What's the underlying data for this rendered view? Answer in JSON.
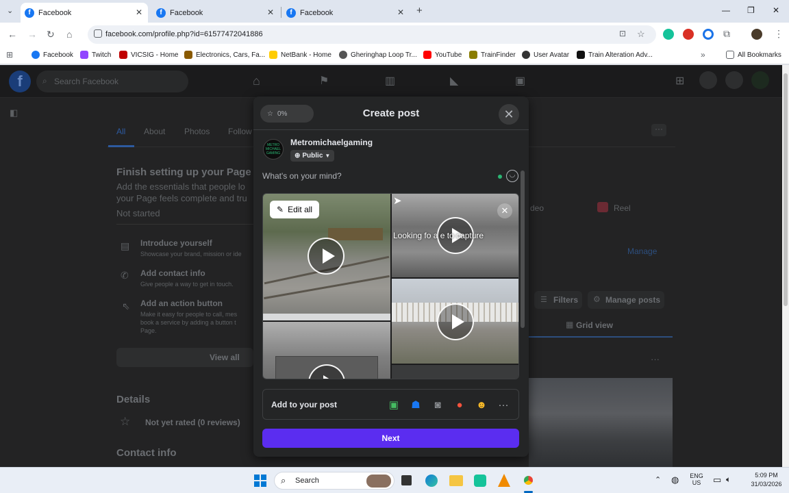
{
  "browser": {
    "tabs": [
      {
        "title": "Facebook",
        "active": true
      },
      {
        "title": "Facebook",
        "active": false
      },
      {
        "title": "Facebook",
        "active": false
      }
    ],
    "url": "facebook.com/profile.php?id=61577472041886",
    "bookmarks": [
      {
        "label": "Facebook",
        "color": "#1877f2"
      },
      {
        "label": "Twitch",
        "color": "#9146ff"
      },
      {
        "label": "VICSIG - Home",
        "color": "#c00000"
      },
      {
        "label": "Electronics, Cars, Fa...",
        "color": "#8a5a00"
      },
      {
        "label": "NetBank - Home",
        "color": "#ffcc00"
      },
      {
        "label": "Gheringhap Loop Tr...",
        "color": "#555555"
      },
      {
        "label": "YouTube",
        "color": "#ff0000"
      },
      {
        "label": "TrainFinder",
        "color": "#8a7d00"
      },
      {
        "label": "User Avatar",
        "color": "#333333"
      },
      {
        "label": "Train Alteration Adv...",
        "color": "#111111"
      }
    ],
    "all_bookmarks": "All Bookmarks"
  },
  "fb": {
    "search_placeholder": "Search Facebook",
    "page_tabs": [
      "All",
      "About",
      "Photos",
      "Follow"
    ],
    "setup_title": "Finish setting up your Page",
    "setup_desc_1": "Add the essentials that people lo",
    "setup_desc_2": "your Page feels complete and tru",
    "setup_status": "Not started",
    "items": [
      {
        "title": "Introduce yourself",
        "desc": "Showcase your brand, mission or ide"
      },
      {
        "title": "Add contact info",
        "desc": "Give people a way to get in touch."
      },
      {
        "title": "Add an action button",
        "desc": "Make it easy for people to call, mes",
        "desc2": "book a service by adding a button t",
        "desc3": "Page."
      }
    ],
    "view_all": "View all",
    "details_heading": "Details",
    "rating": "Not yet rated (0 reviews)",
    "contact_heading": "Contact info",
    "right_video": "deo",
    "right_reel": "Reel",
    "manage": "Manage",
    "filters": "Filters",
    "manage_posts": "Manage posts",
    "grid_view": "Grid view"
  },
  "modal": {
    "progress": "0%",
    "title": "Create post",
    "author": "Metromichaelgaming",
    "privacy": "Public",
    "composer_placeholder": "What's on your mind?",
    "edit_all": "Edit all",
    "overlay_text": "Looking fo  a      e to capture",
    "add_to_post": "Add to your post",
    "next": "Next",
    "avatar_text": "METRO MICHAEL GAMING",
    "add_icons": [
      "photo-video-icon",
      "tag-people-icon",
      "live-video-icon",
      "check-in-icon",
      "feeling-icon",
      "more-icon"
    ]
  },
  "taskbar": {
    "search": "Search",
    "lang": "ENG",
    "region": "US",
    "time": "5:09 PM",
    "date": "31/03/2026"
  }
}
